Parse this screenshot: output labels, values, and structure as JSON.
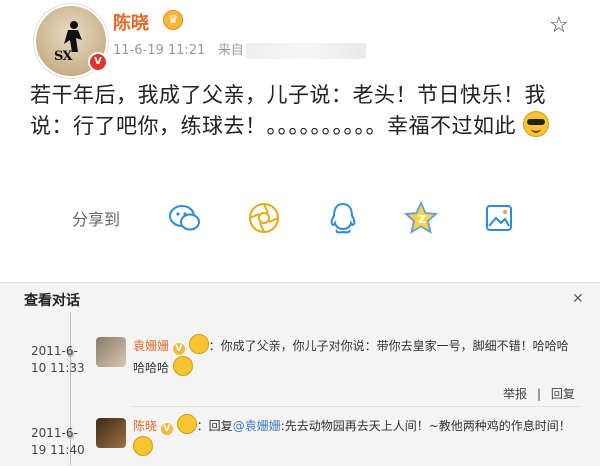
{
  "post": {
    "username": "陈晓",
    "timestamp": "11-6-19 11:21",
    "source_prefix": "来自",
    "text": "若干年后，我成了父亲，儿子说：老头！节日快乐！我说：行了吧你，练球去！。。。。。。。。。。幸福不过如此",
    "avatar_text": "SX"
  },
  "share": {
    "label": "分享到",
    "icons": [
      "wechat-icon",
      "moments-icon",
      "qq-icon",
      "qzone-icon",
      "gallery-icon"
    ]
  },
  "conversation": {
    "title": "查看对话",
    "comments": [
      {
        "date": "2011-6-",
        "time": "10 11:33",
        "name": "袁姗姗",
        "text_line1": "：你成了父亲，你儿子对你说：带你去皇家一号，脚细不错！哈哈哈",
        "text_line2": "哈哈哈"
      },
      {
        "date": "2011-6-",
        "time": "19 11:40",
        "name": "陈晓",
        "reply_prefix": "：回复",
        "mention": "@袁姗姗",
        "text_line1": ":先去动物园再去天上人间！~教他两种鸡的作息时间！"
      }
    ],
    "actions": [
      "举报",
      "回复"
    ]
  },
  "colors": {
    "accent_orange": "#e6692a",
    "link_blue": "#3a7bbf",
    "verified_red": "#e0332f"
  }
}
